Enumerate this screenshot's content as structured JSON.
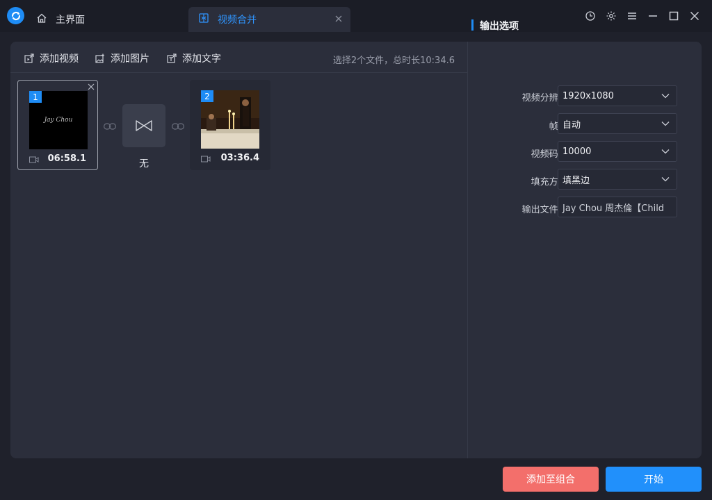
{
  "titlebar": {
    "tabs": [
      {
        "label": "主界面",
        "icon": "home-icon"
      },
      {
        "label": "视频合并",
        "icon": "merge-icon"
      }
    ]
  },
  "toolbar": {
    "add_video": "添加视频",
    "add_image": "添加图片",
    "add_text": "添加文字",
    "summary": "选择2个文件，总时长10:34.6"
  },
  "clips": [
    {
      "index": "1",
      "duration": "06:58.1",
      "thumb_text": "Jay Chou"
    },
    {
      "index": "2",
      "duration": "03:36.4"
    }
  ],
  "transition": {
    "label": "无"
  },
  "options": {
    "title": "输出选项",
    "resolution_label": "视频分辨率:",
    "resolution_value": "1920x1080",
    "framerate_label": "帧率:",
    "framerate_value": "自动",
    "bitrate_label": "视频码率:",
    "bitrate_value": "10000",
    "fill_label": "填充方式:",
    "fill_value": "填黑边",
    "filename_label": "输出文件名:",
    "filename_value": "Jay Chou 周杰倫【Child"
  },
  "buttons": {
    "add_to_combo": "添加至组合",
    "start": "开始"
  },
  "colors": {
    "accent": "#1e8cf5",
    "start_button": "#2190fb",
    "add_button": "#f36f6b",
    "background": "#1f212b",
    "panel": "#2b2e3b"
  }
}
